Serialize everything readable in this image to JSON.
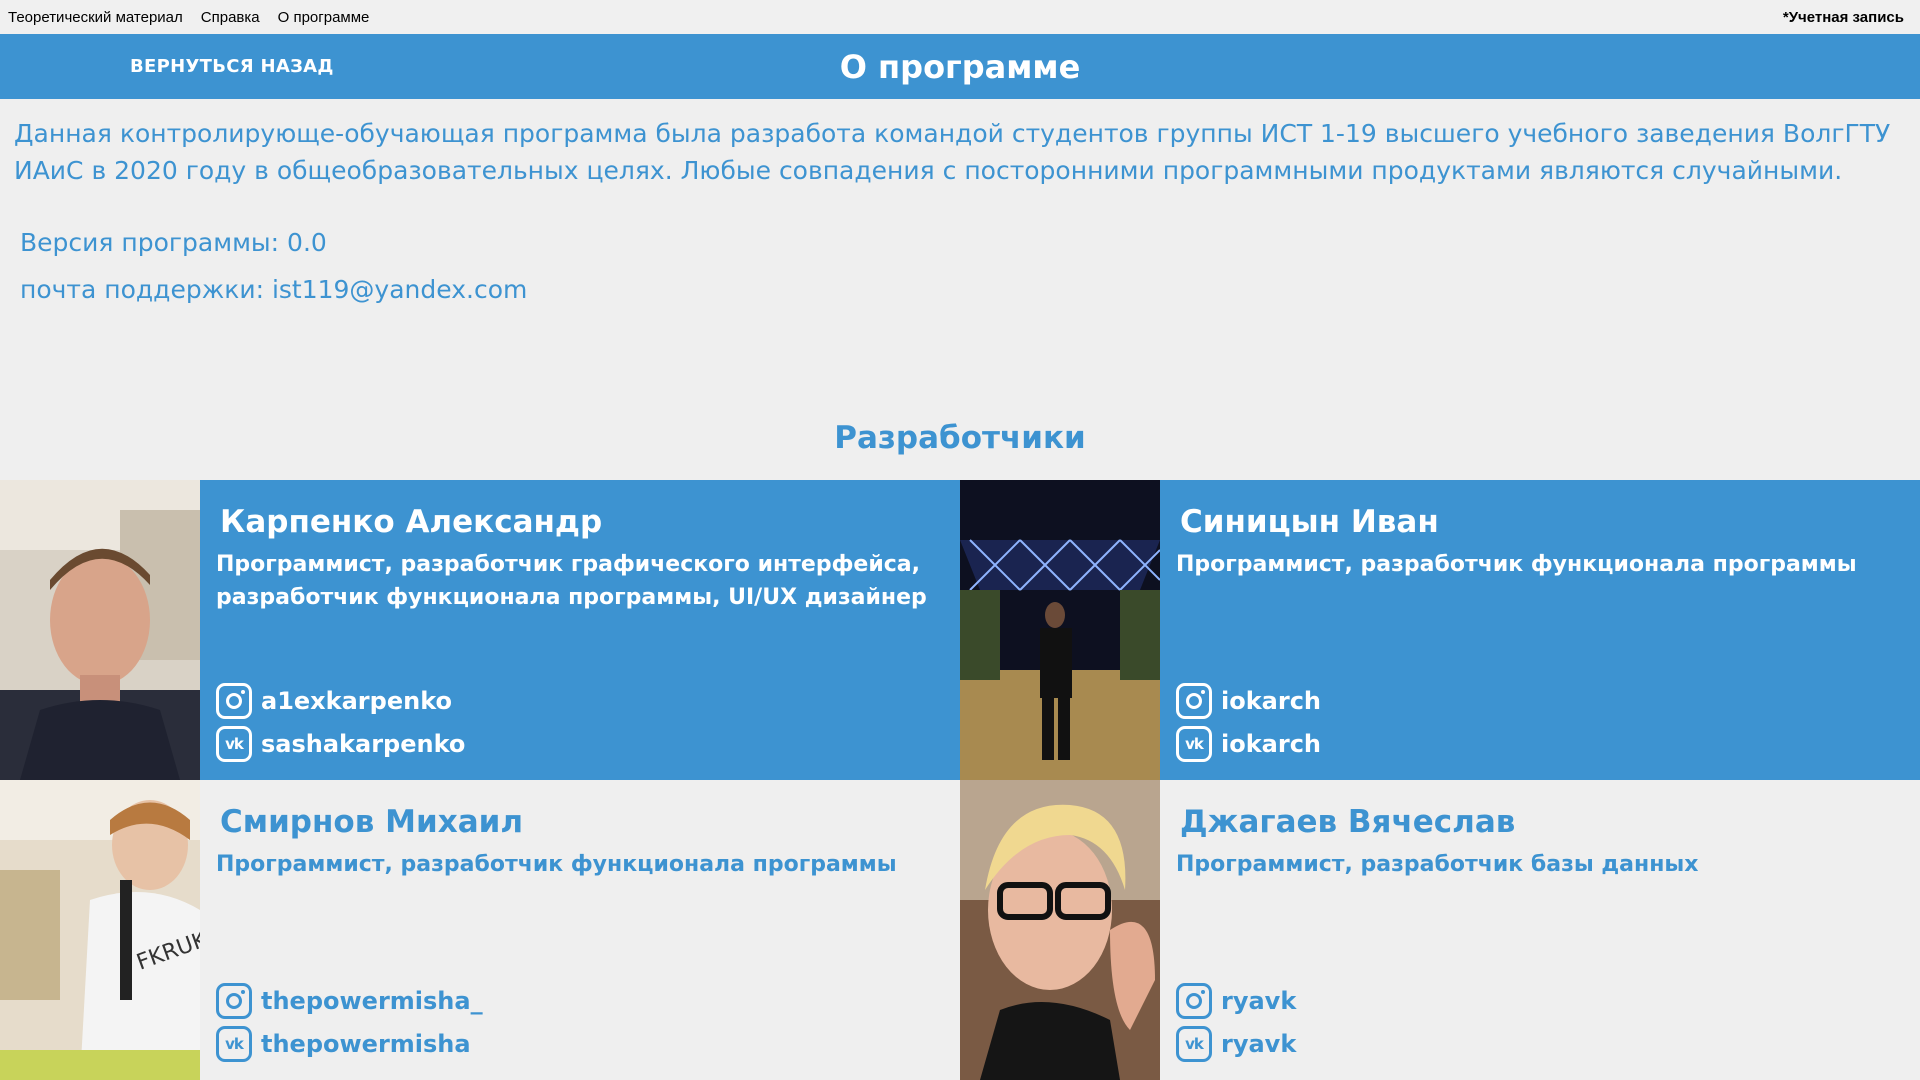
{
  "menu": {
    "items": [
      "Теоретический материал",
      "Справка",
      "О программе"
    ],
    "account": "*Учетная запись"
  },
  "header": {
    "back_label": "ВЕРНУТЬСЯ НАЗАД",
    "title": "О программе"
  },
  "description": "Данная контролирующе-обучающая программа была разработа командой студентов группы ИСТ 1-19 высшего учебного заведения ВолгГТУ ИАиС в 2020 году в общеобразовательных целях. Любые совпадения с посторонними программными продуктами являются случайными.",
  "info": {
    "version": "Версия программы: 0.0",
    "support": "почта поддержки: ist119@yandex.com"
  },
  "developers_title": "Разработчики",
  "developers": [
    {
      "name": "Карпенко Александр",
      "role": "Программист, разработчик графического интерфейса, разработчик функционала программы, UI/UX дизайнер",
      "instagram": "a1exkarpenko",
      "vk": "sashakarpenko",
      "theme": "blue"
    },
    {
      "name": "Синицын Иван",
      "role": "Программист, разработчик функционала программы",
      "instagram": "iokarch",
      "vk": "iokarch",
      "theme": "blue"
    },
    {
      "name": "Смирнов Михаил",
      "role": "Программист, разработчик функционала программы",
      "instagram": "thepowermisha_",
      "vk": "thepowermisha",
      "theme": "light"
    },
    {
      "name": "Джагаев Вячеслав",
      "role": "Программист, разработчик базы данных",
      "instagram": "ryavk",
      "vk": "ryavk",
      "theme": "light"
    }
  ],
  "colors": {
    "accent": "#3d93d1",
    "background": "#efefef"
  }
}
